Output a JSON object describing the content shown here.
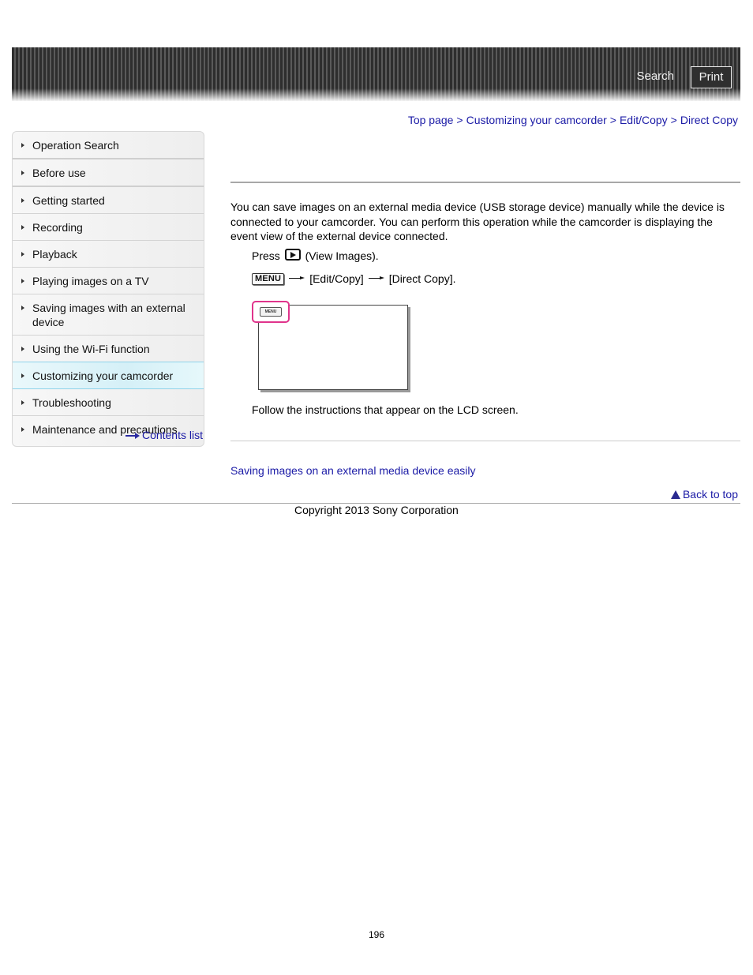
{
  "header": {
    "search_label": "Search",
    "print_label": "Print"
  },
  "breadcrumb": {
    "items": [
      "Top page",
      "Customizing your camcorder",
      "Edit/Copy",
      "Direct Copy"
    ],
    "separator": ">"
  },
  "sidebar": {
    "items": [
      {
        "label": "Operation Search",
        "active": false
      },
      {
        "label": "Before use",
        "active": false
      },
      {
        "label": "Getting started",
        "active": false
      },
      {
        "label": "Recording",
        "active": false
      },
      {
        "label": "Playback",
        "active": false
      },
      {
        "label": "Playing images on a TV",
        "active": false
      },
      {
        "label": "Saving images with an external device",
        "active": false
      },
      {
        "label": "Using the Wi-Fi function",
        "active": false
      },
      {
        "label": "Customizing your camcorder",
        "active": true
      },
      {
        "label": "Troubleshooting",
        "active": false
      },
      {
        "label": "Maintenance and precautions",
        "active": false
      }
    ],
    "contents_link": "Contents list"
  },
  "main": {
    "intro": "You can save images on an external media device (USB storage device) manually while the device is connected to your camcorder. You can perform this operation while the camcorder is displaying the event view of the external device connected.",
    "step1": {
      "prefix": "Press",
      "icon": "view-images-icon",
      "suffix": "(View Images)."
    },
    "step2": {
      "menu_label": "MENU",
      "item1": "[Edit/Copy]",
      "item2": "[Direct Copy]."
    },
    "lcd_menu_label": "MENU",
    "step3": "Follow the instructions that appear on the LCD screen.",
    "related_link": "Saving images on an external media device easily",
    "back_to_top": "Back to top"
  },
  "footer": {
    "copyright": "Copyright 2013 Sony Corporation",
    "page_number": "196"
  },
  "colors": {
    "link": "#1a1aa6",
    "highlight": "#e0348c",
    "active_border": "#8fd3ea"
  }
}
